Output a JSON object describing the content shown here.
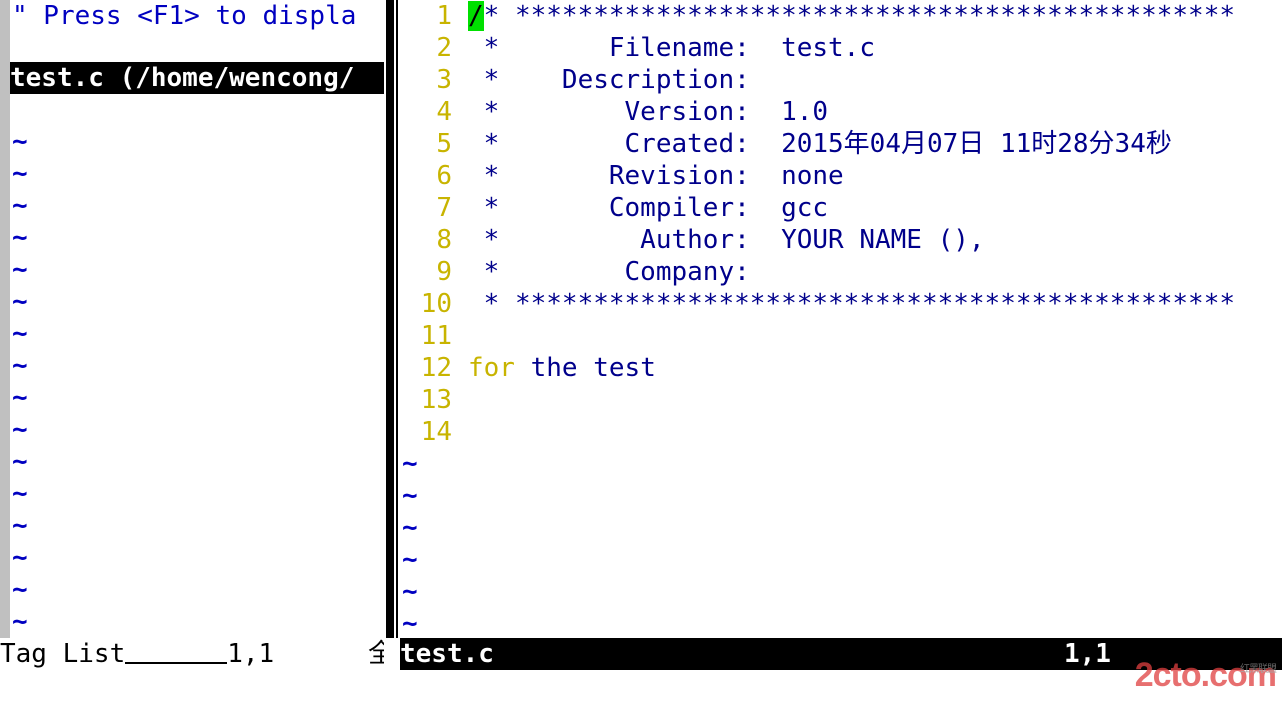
{
  "taglist": {
    "hint": "\" Press <F1> to displa",
    "file_header": "test.c (/home/wencong/",
    "tildes": [
      "~",
      "~",
      "~",
      "~",
      "~",
      "~",
      "~",
      "~",
      "~",
      "~",
      "~",
      "~",
      "~",
      "~",
      "~",
      "~"
    ]
  },
  "editor": {
    "lines": [
      {
        "num": "1",
        "text": "* **********************************************"
      },
      {
        "num": "2",
        "text": " *       Filename:  test.c"
      },
      {
        "num": "3",
        "text": " *    Description:"
      },
      {
        "num": "4",
        "text": " *        Version:  1.0"
      },
      {
        "num": "5",
        "text": " *        Created:  2015年04月07日 11时28分34秒"
      },
      {
        "num": "6",
        "text": " *       Revision:  none"
      },
      {
        "num": "7",
        "text": " *       Compiler:  gcc"
      },
      {
        "num": "8",
        "text": " *         Author:  YOUR NAME (),"
      },
      {
        "num": "9",
        "text": " *        Company:"
      },
      {
        "num": "10",
        "text": " * **********************************************"
      },
      {
        "num": "11",
        "text": ""
      },
      {
        "num": "12",
        "kw": "for",
        "text": " the test"
      },
      {
        "num": "13",
        "text": ""
      },
      {
        "num": "14",
        "text": ""
      }
    ],
    "cursor_char": "/",
    "tildes": [
      "~",
      "~",
      "~",
      "~",
      "~",
      "~"
    ]
  },
  "status": {
    "left_name": "Tag List",
    "left_pos": "1,1",
    "left_scroll": "全部",
    "right_name": "test.c",
    "right_pos": "1,1"
  },
  "watermark": {
    "text": "2cto.com",
    "sub": "红黑联盟"
  },
  "colors": {
    "line_number": "#c8b400",
    "comment": "#00008b",
    "tilde": "#0000c0",
    "cursor": "#00e000",
    "statusline_bg": "#000000"
  }
}
